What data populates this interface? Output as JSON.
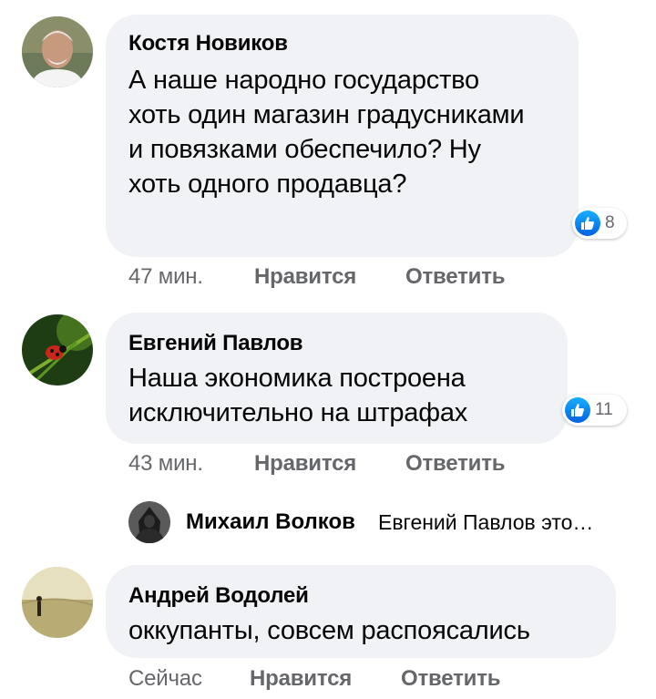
{
  "comments": [
    {
      "author": "Костя Новиков",
      "text": "А наше народно государство хоть один магазин градусниками и повязками обеспечило? Ну хоть одного продавца?",
      "reaction_count": "8",
      "time": "47 мин.",
      "like_label": "Нравится",
      "reply_label": "Ответить"
    },
    {
      "author": "Евгений Павлов",
      "text": "Наша экономика построена исключительно на штрафах",
      "reaction_count": "11",
      "time": "43 мин.",
      "like_label": "Нравится",
      "reply_label": "Ответить",
      "reply_preview": {
        "author": "Михаил Волков",
        "text": "Евгений Павлов это…"
      }
    },
    {
      "author": "Андрей Водолей",
      "text": "оккупанты, совсем распоясались",
      "time": "Сейчас",
      "like_label": "Нравится",
      "reply_label": "Ответить"
    }
  ],
  "colors": {
    "bubble": "#f0f2f5",
    "secondary_text": "#65676b",
    "like_blue": "#1877f2"
  },
  "icons": {
    "reaction": "like-thumbs-up-icon"
  }
}
